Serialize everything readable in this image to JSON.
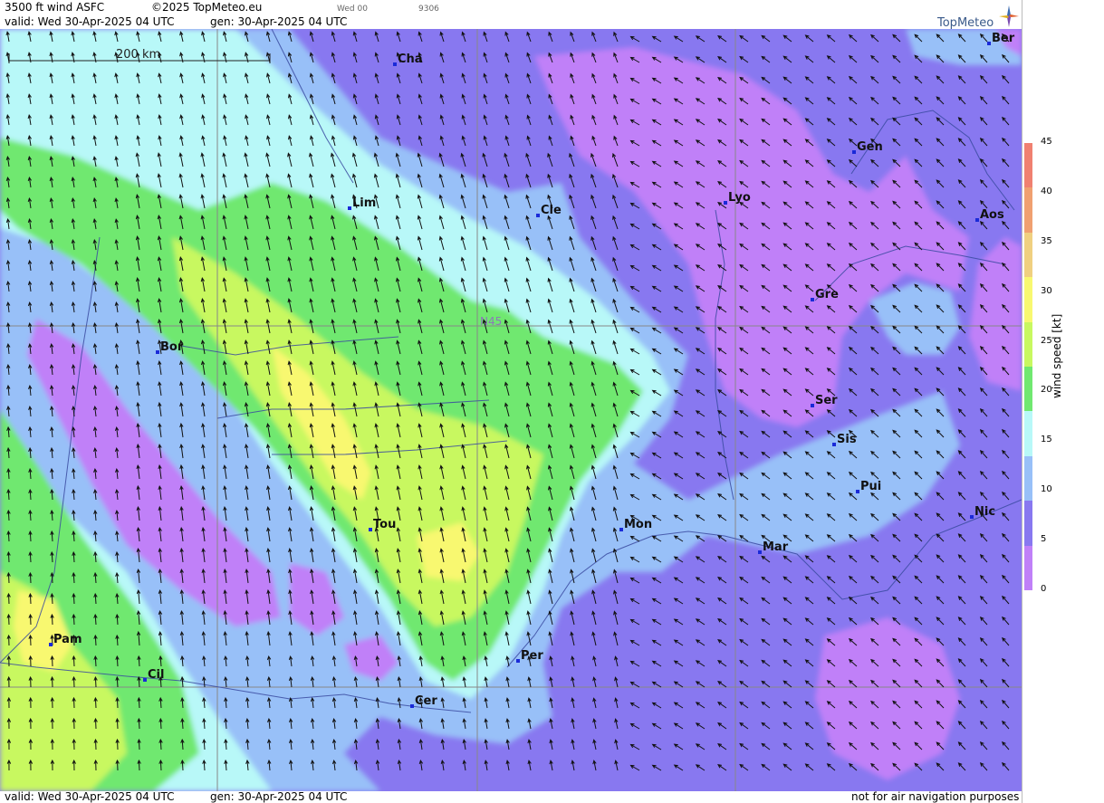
{
  "header": {
    "product": "3500 ft wind ASFC",
    "copyright": "©2025 TopMeteo.eu",
    "run": "Wed 00",
    "code": "9306",
    "valid": "valid:  Wed  30-Apr-2025  04 UTC",
    "gen": "gen:  30-Apr-2025  04 UTC"
  },
  "footer": {
    "valid": "valid:  Wed  30-Apr-2025  04 UTC",
    "gen": "gen:  30-Apr-2025  04 UTC",
    "disclaimer": "not for air navigation purposes"
  },
  "logo": {
    "text": "TopMeteo"
  },
  "map": {
    "scale_label": "200 km",
    "lat_label": "N45",
    "cities": [
      {
        "name": "Cha"
      },
      {
        "name": "Lim"
      },
      {
        "name": "Cle"
      },
      {
        "name": "Lyo"
      },
      {
        "name": "Gen"
      },
      {
        "name": "Ber"
      },
      {
        "name": "Aos"
      },
      {
        "name": "Gre"
      },
      {
        "name": "Bor"
      },
      {
        "name": "Ser"
      },
      {
        "name": "Sis"
      },
      {
        "name": "Pui"
      },
      {
        "name": "Tou"
      },
      {
        "name": "Mon"
      },
      {
        "name": "Mar"
      },
      {
        "name": "Nic"
      },
      {
        "name": "Pam"
      },
      {
        "name": "Cil"
      },
      {
        "name": "Per"
      },
      {
        "name": "Cer"
      }
    ]
  },
  "legend": {
    "title": "wind  speed  [kt]",
    "ticks": [
      "45",
      "40",
      "35",
      "30",
      "25",
      "20",
      "15",
      "10",
      "5",
      "0"
    ],
    "colors": [
      "#f08070",
      "#f0a070",
      "#f0d080",
      "#f8f870",
      "#c8f860",
      "#70e870",
      "#b8f8f8",
      "#98c0f8",
      "#8878f0",
      "#c080f8"
    ]
  }
}
